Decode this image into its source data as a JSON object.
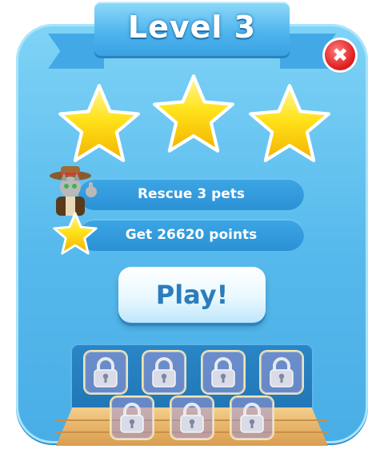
{
  "header": {
    "title": "Level 3"
  },
  "stars": {
    "earned": 3,
    "total": 3
  },
  "objectives": [
    {
      "label": "Rescue 3 pets",
      "icon": "cat-explorer-avatar"
    },
    {
      "label": "Get 26620 points",
      "icon": "star-icon"
    }
  ],
  "play_button": {
    "label": "Play!"
  },
  "close_button": {
    "icon": "close-icon",
    "glyph": "✖"
  },
  "pet_slots": {
    "count": 7,
    "state": "locked",
    "icon": "padlock-icon"
  },
  "colors": {
    "panel": "#56b9ec",
    "ribbon": "#4cb3ee",
    "star": "#ffd400",
    "close": "#e02020",
    "play_text": "#2b7dbd",
    "shelf": "#e7b46a"
  }
}
